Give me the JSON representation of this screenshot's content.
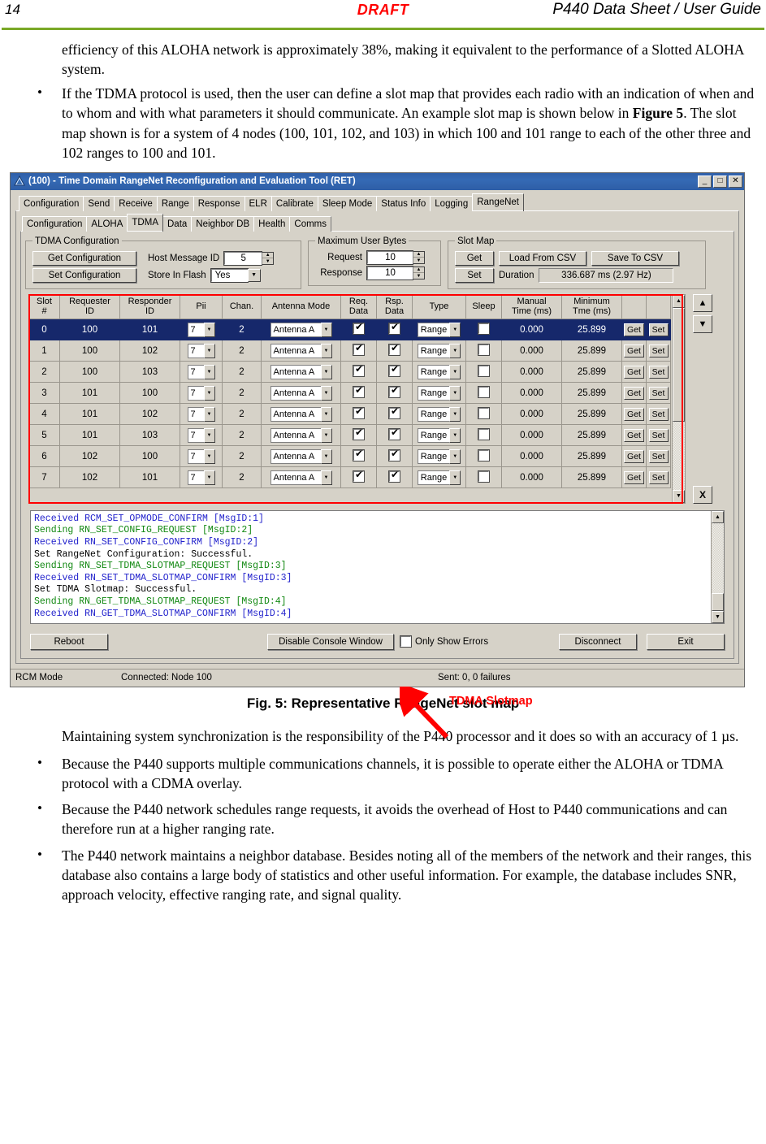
{
  "page_header": {
    "page_number": "14",
    "draft_mark": "DRAFT",
    "doc_title": "P440 Data Sheet / User Guide"
  },
  "doc": {
    "intro_paragraph": "efficiency of this  ALOHA network is approximately 38%, making it equivalent to the performance of a Slotted ALOHA system.",
    "bullet_1_part1": "If the TDMA protocol is used, then the user can define a slot map that provides each radio with an indication of when and to whom and with what parameters it should communicate. An example slot map is shown below in ",
    "bullet_1_bold": "Figure 5",
    "bullet_1_part2": ".  The slot map shown is for a system of 4 nodes (100, 101, 102, and 103) in which 100 and 101 range to each of the other three and 102 ranges to 100 and 101.",
    "figure_caption": "Fig. 5:  Representative RangeNet slot map",
    "after_paragraph": "Maintaining system synchronization is the responsibility of the P440 processor and it does so with an accuracy of 1 µs.",
    "bullet_2": "Because the P440 supports multiple communications channels, it is possible to operate either the ALOHA or TDMA protocol with a CDMA overlay.",
    "bullet_3": "Because the P440 network schedules range requests, it avoids the overhead of Host to P440 communications and can therefore run at a higher ranging rate.",
    "bullet_4": "The P440 network maintains a neighbor database.  Besides noting all of the members of the network and their ranges, this database also contains a large body of statistics and other useful information.  For example, the database includes SNR, approach velocity, effective ranging rate, and signal quality."
  },
  "annotation": {
    "label": "TDMA Slotmap",
    "color": "#ff0000"
  },
  "window": {
    "title": "(100) - Time Domain RangeNet Reconfiguration and Evaluation Tool (RET)",
    "controls": {
      "minimize": "_",
      "maximize": "□",
      "close": "✕"
    },
    "title_bar_color": "#2f5fa8",
    "face_color": "#d6d2c8"
  },
  "tabs_top": [
    {
      "label": "Configuration",
      "selected": false
    },
    {
      "label": "Send",
      "selected": false
    },
    {
      "label": "Receive",
      "selected": false
    },
    {
      "label": "Range",
      "selected": false
    },
    {
      "label": "Response",
      "selected": false
    },
    {
      "label": "ELR",
      "selected": false
    },
    {
      "label": "Calibrate",
      "selected": false
    },
    {
      "label": "Sleep Mode",
      "selected": false
    },
    {
      "label": "Status Info",
      "selected": false
    },
    {
      "label": "Logging",
      "selected": false
    },
    {
      "label": "RangeNet",
      "selected": true
    }
  ],
  "tabs_sub": [
    {
      "label": "Configuration",
      "selected": false
    },
    {
      "label": "ALOHA",
      "selected": false
    },
    {
      "label": "TDMA",
      "selected": true
    },
    {
      "label": "Data",
      "selected": false
    },
    {
      "label": "Neighbor DB",
      "selected": false
    },
    {
      "label": "Health",
      "selected": false
    },
    {
      "label": "Comms",
      "selected": false
    }
  ],
  "tdma_config": {
    "legend": "TDMA Configuration",
    "get_button": "Get Configuration",
    "set_button": "Set Configuration",
    "host_message_id_label": "Host Message ID",
    "host_message_id_value": "5",
    "store_in_flash_label": "Store In Flash",
    "store_in_flash_value": "Yes"
  },
  "max_user_bytes": {
    "legend": "Maximum User Bytes",
    "request_label": "Request",
    "request_value": "10",
    "response_label": "Response",
    "response_value": "10"
  },
  "slot_map_panel": {
    "legend": "Slot Map",
    "get_button": "Get",
    "set_button": "Set",
    "load_csv_button": "Load From CSV",
    "save_csv_button": "Save To CSV",
    "duration_label": "Duration",
    "duration_value": "336.687 ms (2.97 Hz)"
  },
  "slot_table": {
    "headers": [
      "Slot\n#",
      "Requester\nID",
      "Responder\nID",
      "Pii",
      "Chan.",
      "Antenna Mode",
      "Req.\nData",
      "Rsp.\nData",
      "Type",
      "Sleep",
      "Manual\nTime (ms)",
      "Minimum\nTme (ms)"
    ],
    "row_buttons": {
      "get": "Get",
      "set": "Set"
    },
    "rows": [
      {
        "slot": "0",
        "requester": "100",
        "responder": "101",
        "pii": "7",
        "chan": "2",
        "antenna": "Antenna A",
        "req_data": true,
        "rsp_data": true,
        "type": "Range",
        "sleep": false,
        "manual_time": "0.000",
        "min_time": "25.899",
        "selected": true
      },
      {
        "slot": "1",
        "requester": "100",
        "responder": "102",
        "pii": "7",
        "chan": "2",
        "antenna": "Antenna A",
        "req_data": true,
        "rsp_data": true,
        "type": "Range",
        "sleep": false,
        "manual_time": "0.000",
        "min_time": "25.899",
        "selected": false
      },
      {
        "slot": "2",
        "requester": "100",
        "responder": "103",
        "pii": "7",
        "chan": "2",
        "antenna": "Antenna A",
        "req_data": true,
        "rsp_data": true,
        "type": "Range",
        "sleep": false,
        "manual_time": "0.000",
        "min_time": "25.899",
        "selected": false
      },
      {
        "slot": "3",
        "requester": "101",
        "responder": "100",
        "pii": "7",
        "chan": "2",
        "antenna": "Antenna A",
        "req_data": true,
        "rsp_data": true,
        "type": "Range",
        "sleep": false,
        "manual_time": "0.000",
        "min_time": "25.899",
        "selected": false
      },
      {
        "slot": "4",
        "requester": "101",
        "responder": "102",
        "pii": "7",
        "chan": "2",
        "antenna": "Antenna A",
        "req_data": true,
        "rsp_data": true,
        "type": "Range",
        "sleep": false,
        "manual_time": "0.000",
        "min_time": "25.899",
        "selected": false
      },
      {
        "slot": "5",
        "requester": "101",
        "responder": "103",
        "pii": "7",
        "chan": "2",
        "antenna": "Antenna A",
        "req_data": true,
        "rsp_data": true,
        "type": "Range",
        "sleep": false,
        "manual_time": "0.000",
        "min_time": "25.899",
        "selected": false
      },
      {
        "slot": "6",
        "requester": "102",
        "responder": "100",
        "pii": "7",
        "chan": "2",
        "antenna": "Antenna A",
        "req_data": true,
        "rsp_data": true,
        "type": "Range",
        "sleep": false,
        "manual_time": "0.000",
        "min_time": "25.899",
        "selected": false
      },
      {
        "slot": "7",
        "requester": "102",
        "responder": "101",
        "pii": "7",
        "chan": "2",
        "antenna": "Antenna A",
        "req_data": true,
        "rsp_data": true,
        "type": "Range",
        "sleep": false,
        "manual_time": "0.000",
        "min_time": "25.899",
        "selected": false
      }
    ],
    "side_buttons": {
      "up": "▲",
      "down": "▼",
      "delete": "X"
    }
  },
  "console": {
    "lines": [
      {
        "text": "Received RCM_SET_OPMODE_CONFIRM [MsgID:1]",
        "kind": "received"
      },
      {
        "text": "Sending RN_SET_CONFIG_REQUEST [MsgID:2]",
        "kind": "sending"
      },
      {
        "text": "Received RN_SET_CONFIG_CONFIRM [MsgID:2]",
        "kind": "received"
      },
      {
        "text": "Set RangeNet Configuration: Successful.",
        "kind": "plain"
      },
      {
        "text": "Sending RN_SET_TDMA_SLOTMAP_REQUEST [MsgID:3]",
        "kind": "sending"
      },
      {
        "text": "Received RN_SET_TDMA_SLOTMAP_CONFIRM [MsgID:3]",
        "kind": "received"
      },
      {
        "text": "Set TDMA Slotmap: Successful.",
        "kind": "plain"
      },
      {
        "text": "Sending RN_GET_TDMA_SLOTMAP_REQUEST [MsgID:4]",
        "kind": "sending"
      },
      {
        "text": "Received RN_GET_TDMA_SLOTMAP_CONFIRM [MsgID:4]",
        "kind": "received"
      }
    ]
  },
  "bottom_bar": {
    "reboot": "Reboot",
    "disable_console": "Disable Console Window",
    "only_show_errors": "Only Show Errors",
    "only_show_errors_checked": false,
    "disconnect": "Disconnect",
    "exit": "Exit"
  },
  "status_bar": {
    "mode": "RCM Mode",
    "connection": "Connected: Node 100",
    "sent": "Sent: 0, 0 failures"
  }
}
